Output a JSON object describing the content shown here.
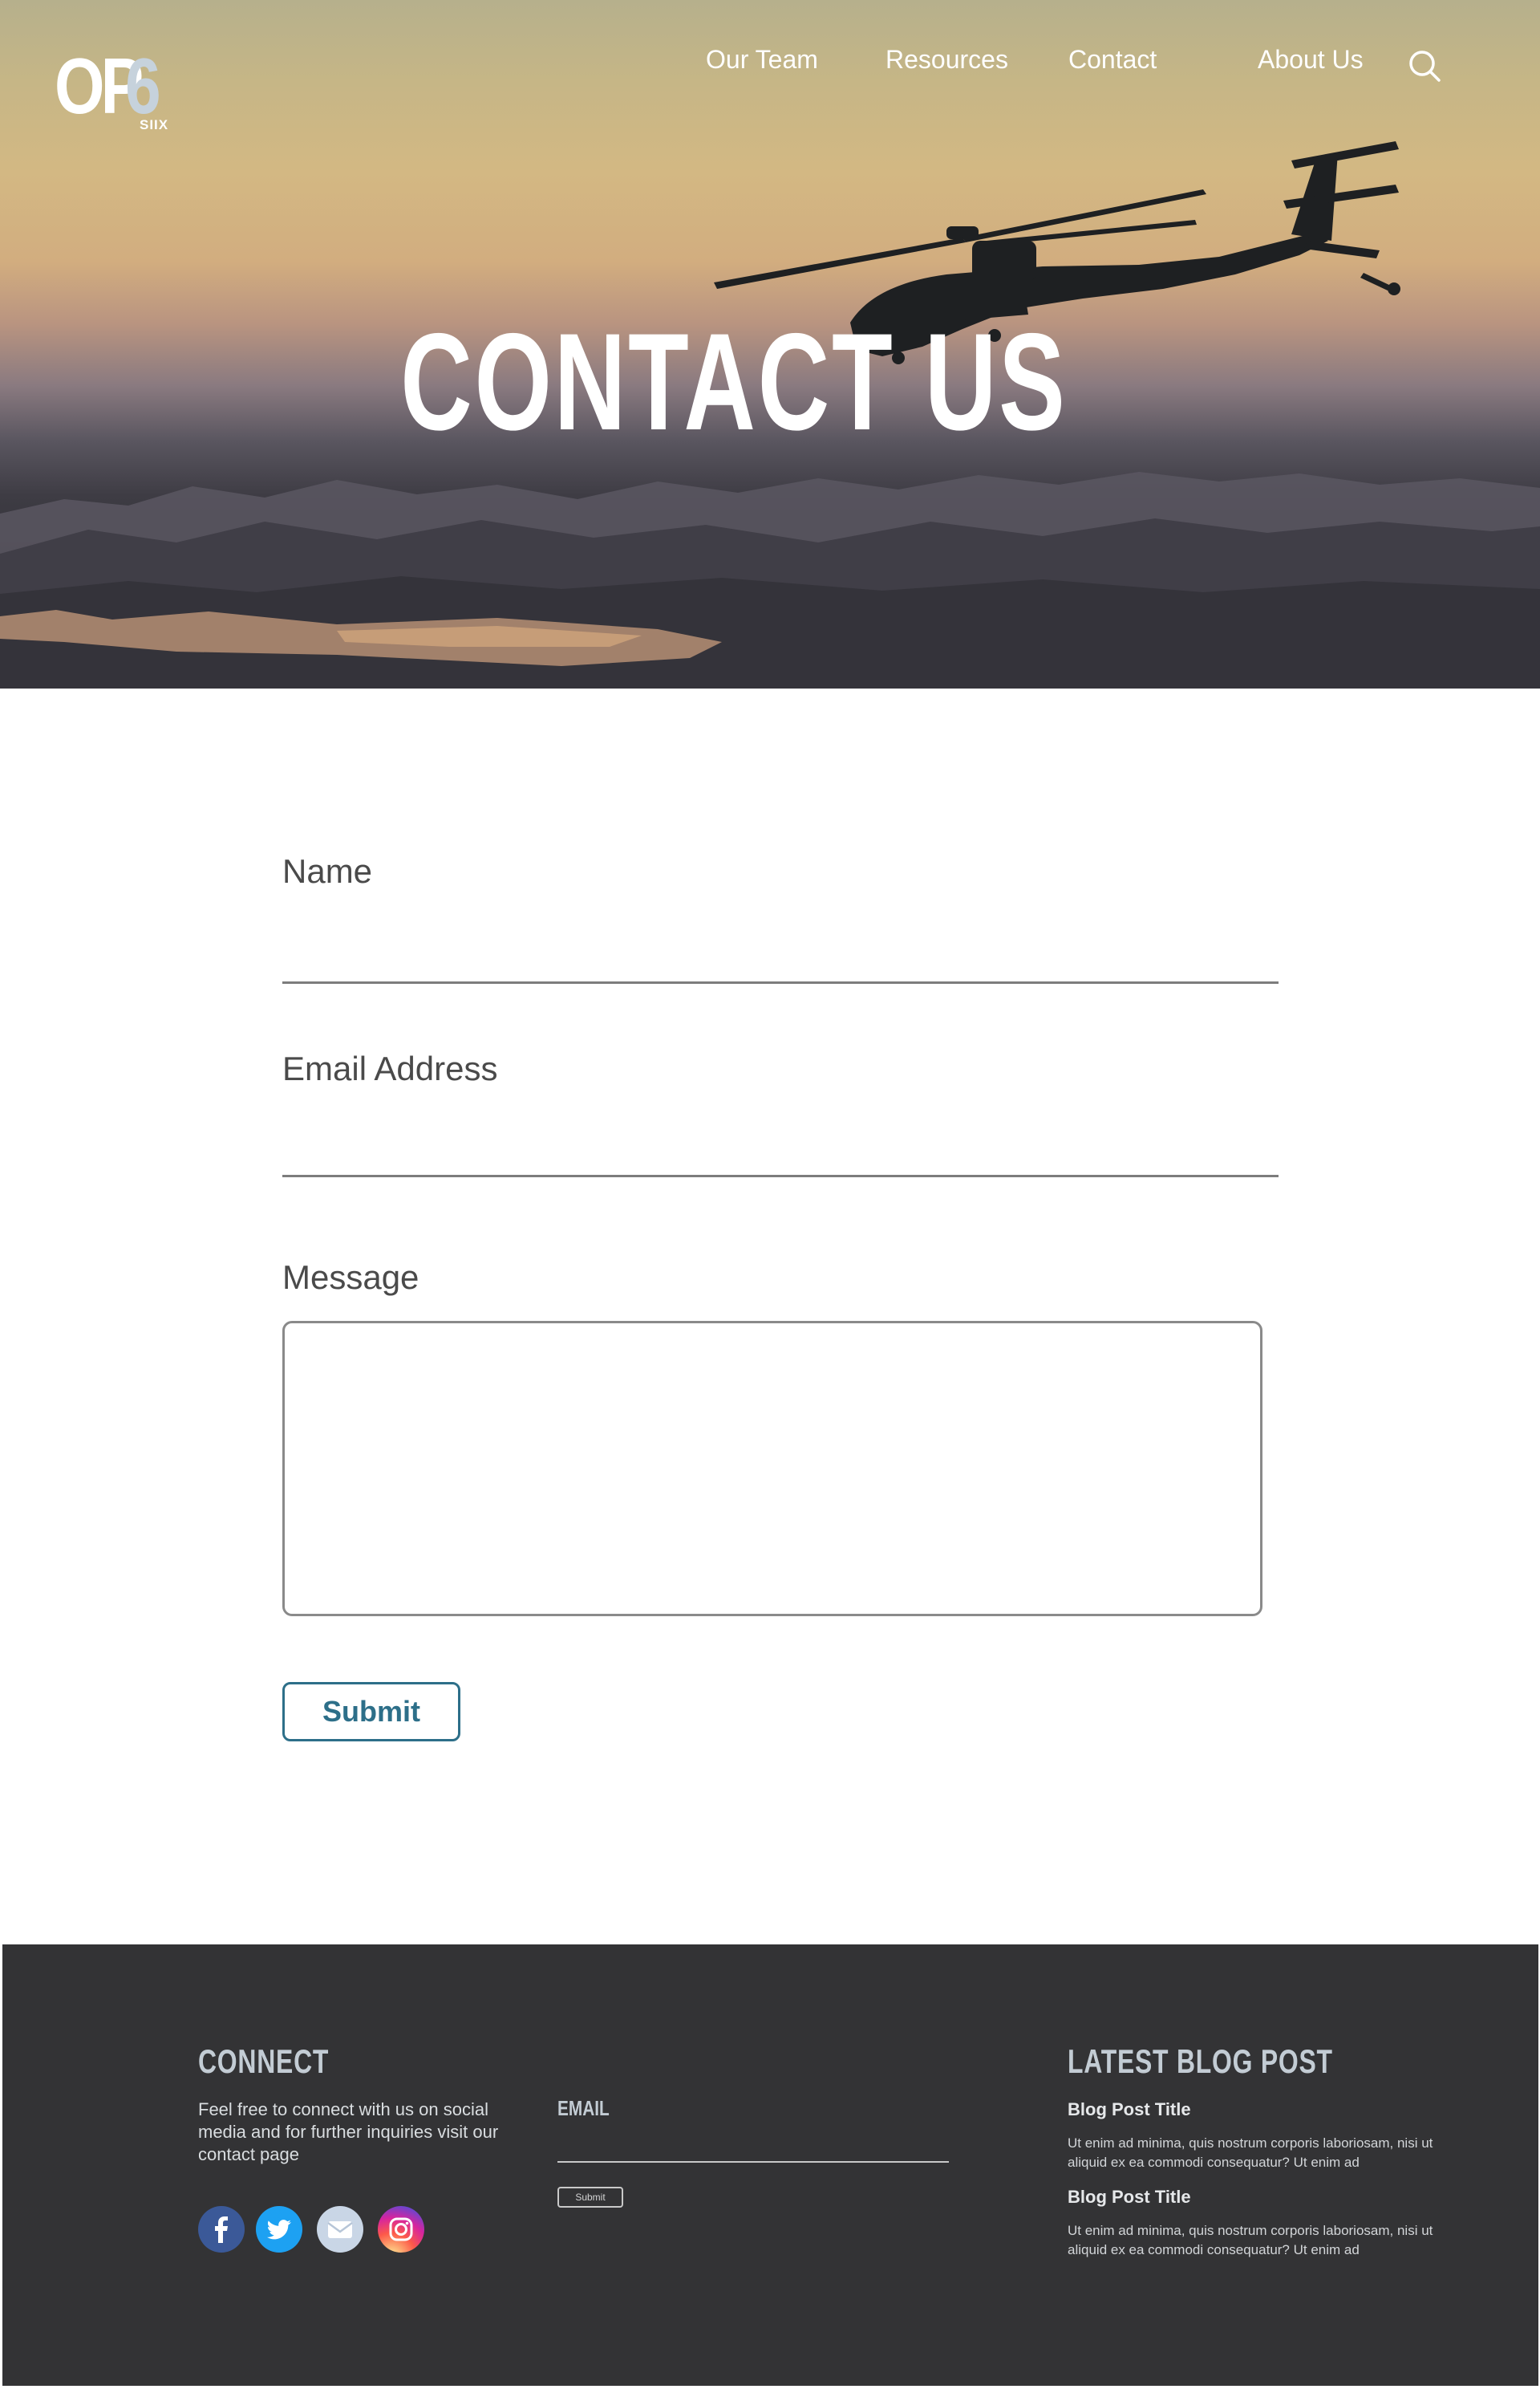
{
  "brand": {
    "logo_main": "OP",
    "logo_number": "6",
    "logo_sub": "SIIX"
  },
  "nav": {
    "items": [
      {
        "label": "Our Team"
      },
      {
        "label": "Resources"
      },
      {
        "label": "Contact"
      },
      {
        "label": "About Us"
      }
    ],
    "search_icon": "search-icon"
  },
  "hero": {
    "title": "CONTACT US"
  },
  "form": {
    "name_label": "Name",
    "name_value": "",
    "email_label": "Email Address",
    "email_value": "",
    "message_label": "Message",
    "message_value": "",
    "submit_label": "Submit",
    "accent_color": "#2d6f89"
  },
  "footer": {
    "background": "#333335",
    "connect": {
      "heading": "CONNECT",
      "text": "Feel free to connect with us on social media and for further inquiries visit our contact page"
    },
    "newsletter": {
      "email_label": "EMAIL",
      "email_value": "",
      "submit_label": "Submit"
    },
    "social_icons": [
      "facebook-icon",
      "twitter-icon",
      "email-icon",
      "instagram-icon"
    ],
    "blog": {
      "heading": "LATEST BLOG POST",
      "posts": [
        {
          "title": "Blog Post Title",
          "excerpt": "Ut enim ad minima, quis nostrum corporis laboriosam, nisi ut aliquid ex ea commodi consequatur? Ut enim ad"
        },
        {
          "title": "Blog Post Title",
          "excerpt": "Ut enim ad minima, quis nostrum corporis laboriosam, nisi ut aliquid ex ea commodi consequatur? Ut enim ad"
        }
      ]
    }
  }
}
